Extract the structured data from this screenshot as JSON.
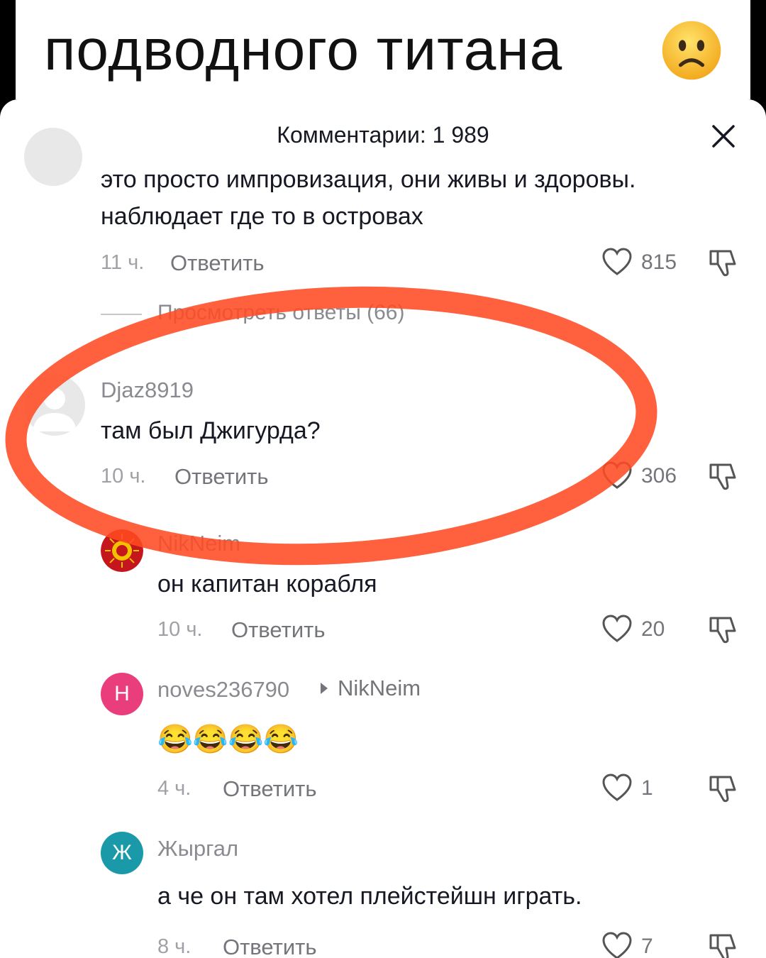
{
  "caption": {
    "text": "подводного титана"
  },
  "sheet": {
    "title": "Комментарии: 1 989",
    "close_icon": "close-icon"
  },
  "comments": [
    {
      "text_line1": "это просто импровизация, они живы и здоровы.",
      "text_line2": "наблюдает где то в островах",
      "time": "11 ч.",
      "reply_label": "Ответить",
      "likes": "815",
      "view_replies": "Просмотреть ответы (66)"
    },
    {
      "username": "Djaz8919",
      "text": "там был Джигурда?",
      "time": "10 ч.",
      "reply_label": "Ответить",
      "likes": "306"
    }
  ],
  "replies": [
    {
      "username": "NikNeim",
      "text": "он капитан корабля",
      "time": "10 ч.",
      "reply_label": "Ответить",
      "likes": "20"
    },
    {
      "avatar_letter": "Н",
      "username": "noves236790",
      "reply_to": "NikNeim",
      "text": "😂😂😂😂",
      "time": "4 ч.",
      "reply_label": "Ответить",
      "likes": "1"
    },
    {
      "avatar_letter": "Ж",
      "username": "Жыргал",
      "text": "а че он там хотел плейстейшн играть.",
      "time": "8 ч.",
      "reply_label": "Ответить",
      "likes": "7"
    }
  ],
  "colors": {
    "highlight": "#ff4a22",
    "avatar_pink": "#ea3d7c",
    "avatar_teal": "#1a9aa8"
  }
}
